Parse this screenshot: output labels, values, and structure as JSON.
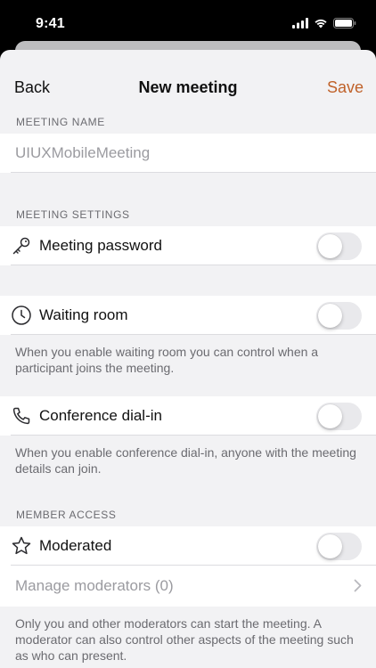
{
  "status_bar": {
    "time": "9:41",
    "icons": [
      "signal-icon",
      "wifi-icon",
      "battery-icon"
    ]
  },
  "nav": {
    "back": "Back",
    "title": "New meeting",
    "save": "Save"
  },
  "meeting_name": {
    "header": "MEETING NAME",
    "placeholder": "UIUXMobileMeeting"
  },
  "meeting_settings": {
    "header": "MEETING SETTINGS",
    "password": {
      "label": "Meeting password",
      "icon": "key-icon",
      "enabled": false
    },
    "waiting_room": {
      "label": "Waiting room",
      "icon": "clock-icon",
      "enabled": false,
      "note": "When you enable waiting room you can control when a participant joins the meeting."
    },
    "dial_in": {
      "label": "Conference dial-in",
      "icon": "phone-icon",
      "enabled": false,
      "note": "When you enable conference dial-in, anyone with the meeting details can join."
    }
  },
  "member_access": {
    "header": "MEMBER ACCESS",
    "moderated": {
      "label": "Moderated",
      "icon": "star-icon",
      "enabled": false
    },
    "manage_moderators": "Manage moderators (0)",
    "note": "Only you and other moderators can start the meeting. A moderator can also control other aspects of the meeting such as who can present."
  },
  "colors": {
    "accent": "#c0622a",
    "background": "#f2f2f4",
    "secondary_text": "#6b6b70"
  }
}
